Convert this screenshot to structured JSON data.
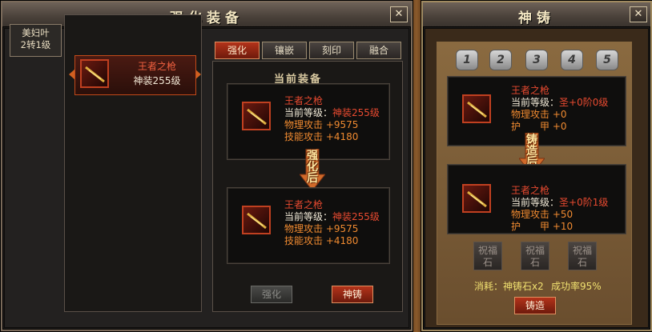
{
  "left_window": {
    "title": "强化装备",
    "close_glyph": "✕",
    "character": {
      "line1": "美妇叶",
      "line2": "2转1级"
    },
    "equip_slot": {
      "name": "王者之枪",
      "level": "神装255级"
    },
    "tabs": [
      {
        "label": "强化",
        "active": true
      },
      {
        "label": "镶嵌",
        "active": false
      },
      {
        "label": "刻印",
        "active": false
      },
      {
        "label": "融合",
        "active": false
      }
    ],
    "section_title": "当前装备",
    "current": {
      "name": "王者之枪",
      "level_label": "当前等级：",
      "level_value": "神装255级",
      "attack_label": "物理攻击",
      "attack_value": "+9575",
      "skill_label": "技能攻击",
      "skill_value": "+4180"
    },
    "arrow_text": [
      "强",
      "化",
      "后"
    ],
    "after": {
      "name": "王者之枪",
      "level_label": "当前等级：",
      "level_value": "神装255级",
      "attack_label": "物理攻击",
      "attack_value": "+9575",
      "skill_label": "技能攻击",
      "skill_value": "+4180"
    },
    "buttons": {
      "enhance": "强化",
      "forge": "神铸"
    }
  },
  "right_window": {
    "title": "神铸",
    "close_glyph": "✕",
    "stage_icons": [
      "1",
      "2",
      "3",
      "4",
      "5"
    ],
    "current": {
      "name": "王者之枪",
      "level_label": "当前等级：",
      "level_value": "圣+0阶0级",
      "attack_label": "物理攻击",
      "attack_value": "+0",
      "armor_label": "护　　甲",
      "armor_value": "+0"
    },
    "arrow_text": [
      "铸",
      "造",
      "后"
    ],
    "after": {
      "name": "王者之枪",
      "level_label": "当前等级：",
      "level_value": "圣+0阶1级",
      "attack_label": "物理攻击",
      "attack_value": "+50",
      "armor_label": "护　　甲",
      "armor_value": "+10"
    },
    "bless_slots": [
      "祝福石",
      "祝福石",
      "祝福石"
    ],
    "cost_text": "消耗：神铸石x2",
    "success_text": "成功率95%",
    "forge_button": "铸造"
  },
  "colors": {
    "accent_red": "#e84a30",
    "stat_orange": "#f08a30",
    "cost_yellow": "#f0e070"
  },
  "icons": {
    "weapon": "spear-icon",
    "close": "close-icon",
    "arrow": "down-arrow-icon"
  }
}
